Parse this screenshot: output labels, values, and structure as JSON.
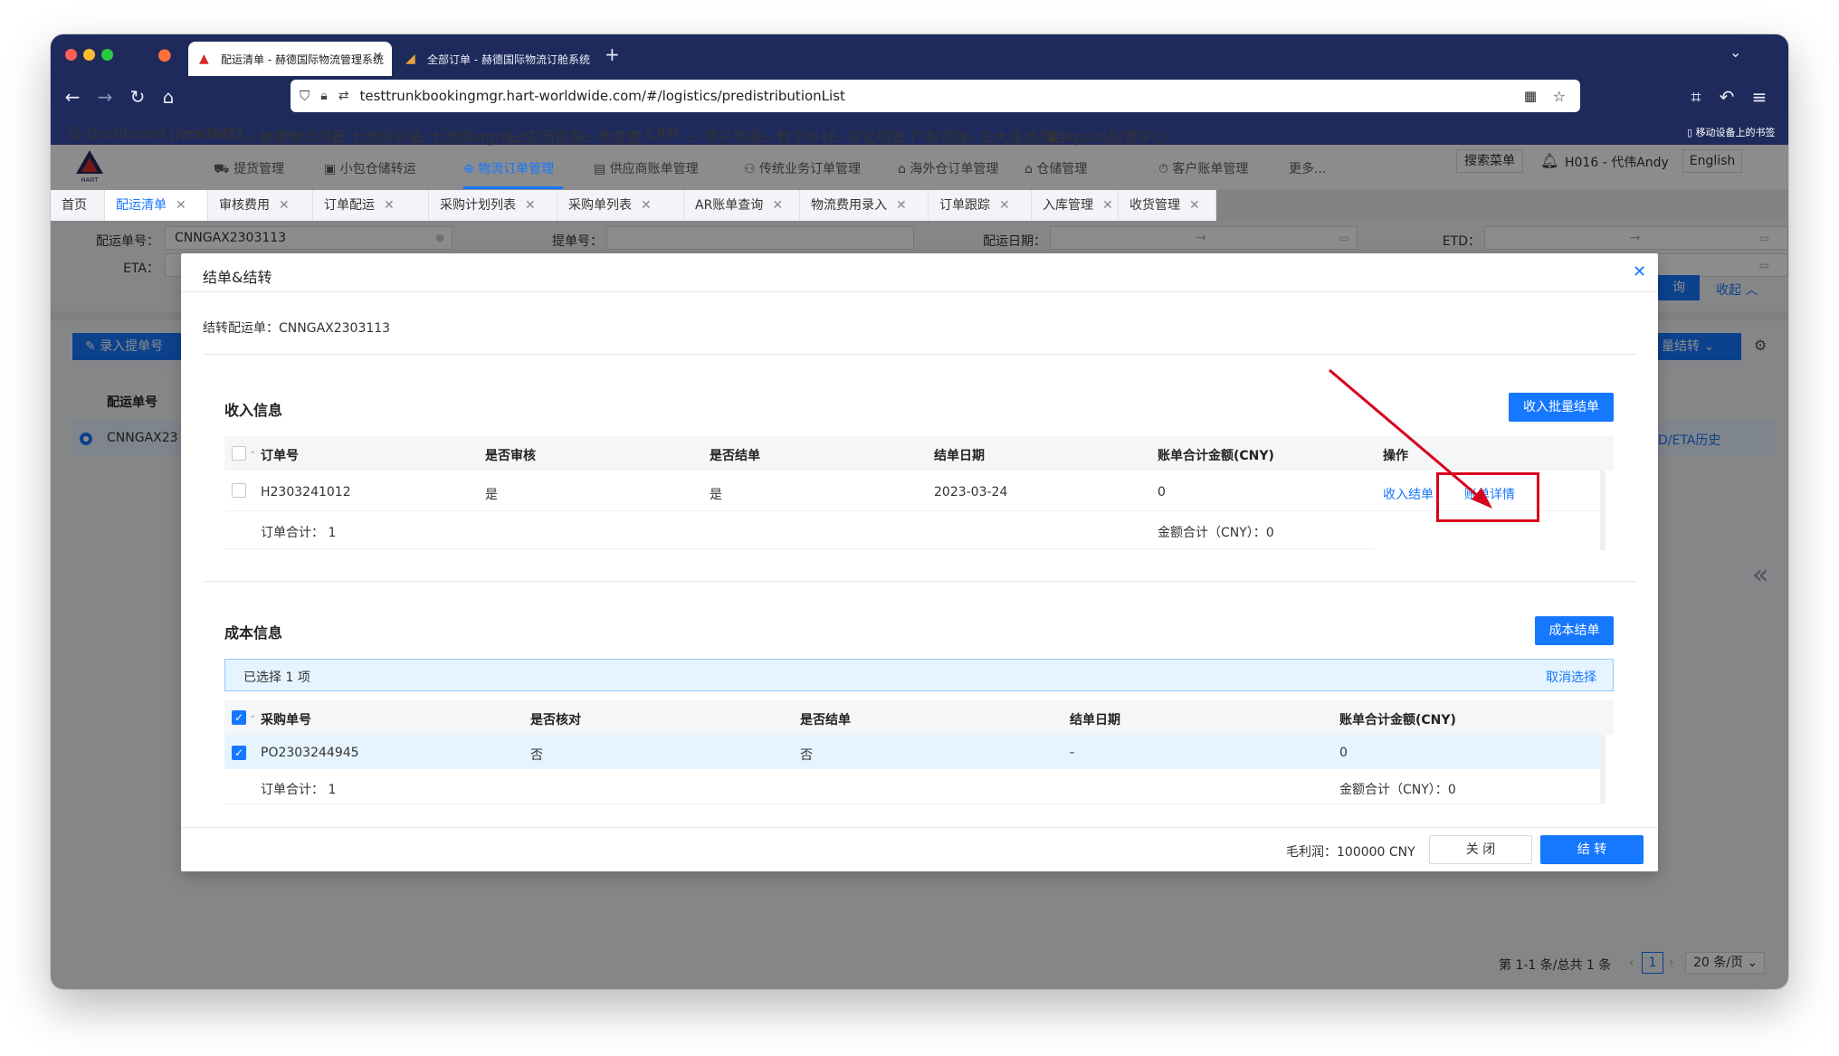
{
  "browser": {
    "tabs": [
      {
        "title": "配运清单 - 赫德国际物流管理系统",
        "active": true
      },
      {
        "title": "全部订单 - 赫德国际物流订舱系统",
        "active": false
      }
    ],
    "url": "testtrunkbookingmgr.hart-worldwide.com/#/logistics/predistributionList",
    "bookmarks": [
      "Dashboard [Jenkins]",
      "TAPD",
      "赫德物流项目",
      "土流网测试",
      "土流网stg/线上",
      "农场管家",
      "地查查",
      "CRM",
      "燕子到家",
      "数字乡村",
      "安化项目",
      "产权项目",
      "五大连池项目",
      "Apollo配置中心"
    ],
    "mobile_bookmarks": "移动设备上的书签"
  },
  "app": {
    "logo_text": "HART",
    "menu": [
      "提货管理",
      "小包仓储转运",
      "物流订单管理",
      "供应商账单管理",
      "传统业务订单管理",
      "海外仓订单管理",
      "仓储管理",
      "客户账单管理",
      "更多..."
    ],
    "search_menu": "搜索菜单",
    "user": "H016 - 代伟Andy",
    "language": "English",
    "page_tabs": [
      "首页",
      "配运清单",
      "审核费用",
      "订单配运",
      "采购计划列表",
      "采购单列表",
      "AR账单查询",
      "物流费用录入",
      "订单跟踪",
      "入库管理",
      "收货管理"
    ],
    "filters": {
      "dist_no_label": "配运单号：",
      "dist_no_value": "CNNGAX2303113",
      "bl_label": "提单号：",
      "dist_date_label": "配运日期：",
      "etd_label": "ETD：",
      "eta_label": "ETA：",
      "collapse": "收起",
      "query_partial": "询"
    },
    "bg_buttons": {
      "add_bl": "录入提单号",
      "batch_partial": "量结转"
    },
    "bg_table": {
      "col1": "配运单号",
      "row1": "CNNGAX23",
      "history": "D/ETA历史"
    },
    "pagination": {
      "summary": "第 1-1 条/总共 1 条",
      "page": "1",
      "page_size": "20 条/页"
    }
  },
  "modal": {
    "title": "结单&结转",
    "transfer_label": "结转配运单：",
    "transfer_value": "CNNGAX2303113",
    "income": {
      "section_title": "收入信息",
      "batch_button": "收入批量结单",
      "columns": [
        "订单号",
        "是否审核",
        "是否结单",
        "结单日期",
        "账单合计金额(CNY)",
        "操作"
      ],
      "rows": [
        {
          "order_no": "H2303241012",
          "audited": "是",
          "closed": "是",
          "close_date": "2023-03-24",
          "amount": "0",
          "action1": "收入结单",
          "action2": "账单详情"
        }
      ],
      "order_total_label": "订单合计：",
      "order_total": "1",
      "amount_total_label": "金额合计（CNY）：",
      "amount_total": "0"
    },
    "cost": {
      "section_title": "成本信息",
      "close_button": "成本结单",
      "selected_prefix": "已选择",
      "selected_count": "1",
      "selected_suffix": "项",
      "cancel_select": "取消选择",
      "columns": [
        "采购单号",
        "是否核对",
        "是否结单",
        "结单日期",
        "账单合计金额(CNY)"
      ],
      "rows": [
        {
          "po_no": "PO2303244945",
          "checked": "否",
          "closed": "否",
          "close_date": "-",
          "amount": "0"
        }
      ],
      "order_total_label": "订单合计：",
      "order_total": "1",
      "amount_total_label": "金额合计（CNY）：",
      "amount_total": "0"
    },
    "footer": {
      "gross_profit_label": "毛利润：",
      "gross_profit": "100000 CNY",
      "close_button": "关 闭",
      "transfer_button": "结 转"
    }
  },
  "colors": {
    "primary": "#1677ff",
    "browser_chrome": "#1f2a5c",
    "annotation": "#d9001b"
  }
}
